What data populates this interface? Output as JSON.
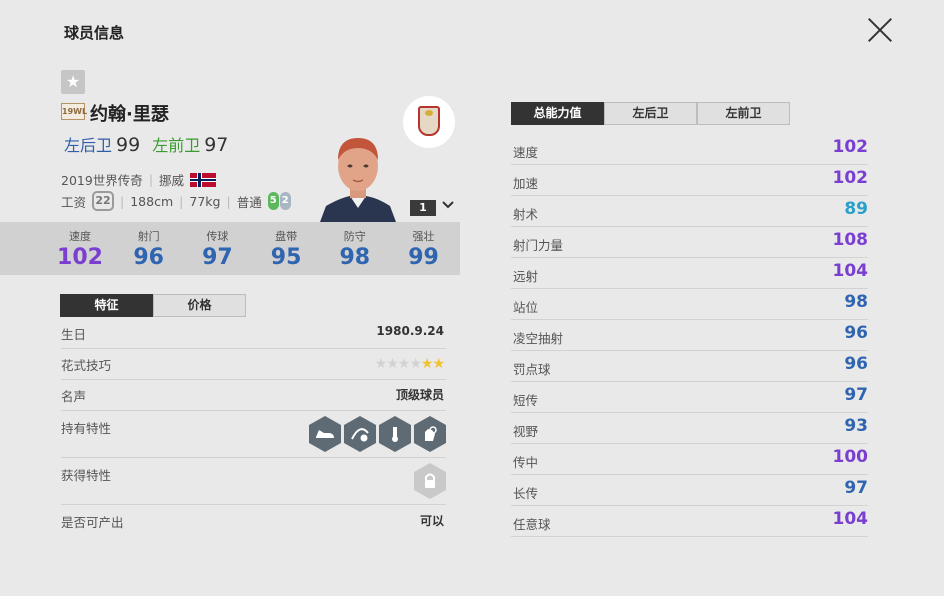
{
  "header": {
    "title": "球员信息"
  },
  "player": {
    "season_badge": "19WL",
    "name": "约翰·里瑟",
    "positions": [
      {
        "name": "左后卫",
        "rating": "99"
      },
      {
        "name": "左前卫",
        "rating": "97"
      }
    ],
    "season_name": "2019世界传奇",
    "nation": "挪威",
    "wage_label": "工资",
    "wage": "22",
    "height": "188cm",
    "weight": "77kg",
    "body_type": "普通",
    "left_foot": "5",
    "right_foot": "2",
    "rank": "1"
  },
  "stats": [
    {
      "label": "速度",
      "value": "102",
      "color": "#7a3fd1"
    },
    {
      "label": "射门",
      "value": "96",
      "color": "#2f64b0"
    },
    {
      "label": "传球",
      "value": "97",
      "color": "#2f64b0"
    },
    {
      "label": "盘带",
      "value": "95",
      "color": "#2f64b0"
    },
    {
      "label": "防守",
      "value": "98",
      "color": "#2f64b0"
    },
    {
      "label": "强壮",
      "value": "99",
      "color": "#2f64b0"
    }
  ],
  "left_tabs": [
    "特征",
    "价格"
  ],
  "info": {
    "birthday_label": "生日",
    "birthday": "1980.9.24",
    "skill_label": "花式技巧",
    "skill_stars": 2,
    "skill_max": 6,
    "fame_label": "名声",
    "fame": "顶级球员",
    "traits_label": "持有特性",
    "traits": [
      "shoe-icon",
      "cross-pass-icon",
      "penalty-icon",
      "hand-ball-icon"
    ],
    "acquired_label": "获得特性",
    "acquired_locked": "lock-icon",
    "producible_label": "是否可产出",
    "producible": "可以"
  },
  "right_tabs": [
    "总能力值",
    "左后卫",
    "左前卫"
  ],
  "attributes": [
    {
      "label": "速度",
      "value": "102",
      "color": "#7a3fd1"
    },
    {
      "label": "加速",
      "value": "102",
      "color": "#7a3fd1"
    },
    {
      "label": "射术",
      "value": "89",
      "color": "#2a9fc9"
    },
    {
      "label": "射门力量",
      "value": "108",
      "color": "#7a3fd1"
    },
    {
      "label": "远射",
      "value": "104",
      "color": "#7a3fd1"
    },
    {
      "label": "站位",
      "value": "98",
      "color": "#2f64b0"
    },
    {
      "label": "凌空抽射",
      "value": "96",
      "color": "#2f64b0"
    },
    {
      "label": "罚点球",
      "value": "96",
      "color": "#2f64b0"
    },
    {
      "label": "短传",
      "value": "97",
      "color": "#2f64b0"
    },
    {
      "label": "视野",
      "value": "93",
      "color": "#2f64b0"
    },
    {
      "label": "传中",
      "value": "100",
      "color": "#7a3fd1"
    },
    {
      "label": "长传",
      "value": "97",
      "color": "#2f64b0"
    },
    {
      "label": "任意球",
      "value": "104",
      "color": "#7a3fd1"
    }
  ]
}
